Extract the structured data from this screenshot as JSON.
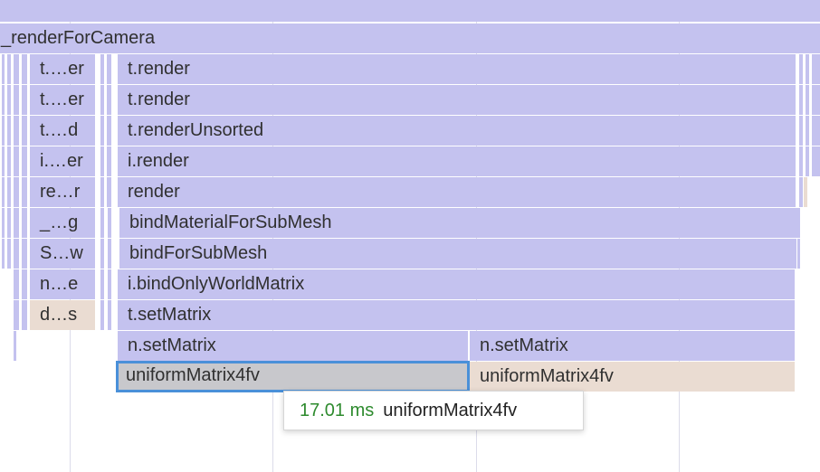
{
  "flame": {
    "rows": [
      {
        "root": "_renderForCamera"
      },
      {
        "left": "t.…er",
        "main": "t.render"
      },
      {
        "left": "t.…er",
        "main": "t.render"
      },
      {
        "left": "t.…d",
        "main": "t.renderUnsorted"
      },
      {
        "left": "i.…er",
        "main": "i.render"
      },
      {
        "left": "re…r",
        "main": "render"
      },
      {
        "left": "_…g",
        "main": "bindMaterialForSubMesh"
      },
      {
        "left": "S…w",
        "main": "bindForSubMesh"
      },
      {
        "left": "n…e",
        "main": "i.bindOnlyWorldMatrix"
      },
      {
        "left": "d…s",
        "main": "t.setMatrix"
      },
      {
        "main": "n.setMatrix",
        "right": "n.setMatrix"
      },
      {
        "main": "uniformMatrix4fv",
        "right": "uniformMatrix4fv"
      }
    ],
    "colors": {
      "frame": "#c4c2ef",
      "highlight": "#eadcd2",
      "selected_fill": "#c8c8cc",
      "selected_border": "#4a90d9",
      "duration_text": "#2e8b2e"
    }
  },
  "tooltip": {
    "duration": "17.01 ms",
    "name": "uniformMatrix4fv"
  }
}
